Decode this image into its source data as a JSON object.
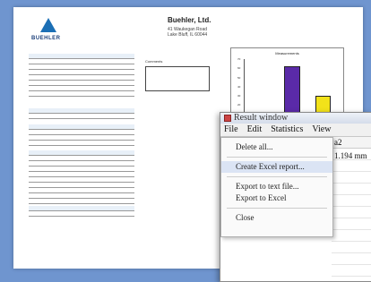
{
  "report": {
    "brand": "BUEHLER",
    "company": "Buehler, Ltd.",
    "address_line1": "41 Waukegan Road",
    "address_line2": "Lake Bluff, IL 60044",
    "comments_label": "Comments"
  },
  "chart_data": {
    "type": "bar",
    "title": "Measurements",
    "categories": [
      "",
      "",
      ""
    ],
    "series": [
      {
        "values": [
          10,
          60,
          28
        ]
      }
    ],
    "colors": [
      "#e02a2a",
      "#5a2aa8",
      "#f2e21a"
    ],
    "ylim": [
      0,
      70
    ],
    "yticks": [
      "70",
      "60",
      "50",
      "40",
      "30",
      "20",
      "10",
      "0"
    ]
  },
  "window": {
    "title": "Result window",
    "menus": [
      "File",
      "Edit",
      "Statistics",
      "View"
    ],
    "column_header": "a2",
    "cell_value": "1.194 mm",
    "file_menu": [
      "Delete all...",
      "Create Excel report...",
      "Export to text file...",
      "Export to Excel",
      "Close"
    ]
  },
  "colors": {
    "desktop": "#6f95cf",
    "menu_highlight": "#dbe4f4"
  }
}
